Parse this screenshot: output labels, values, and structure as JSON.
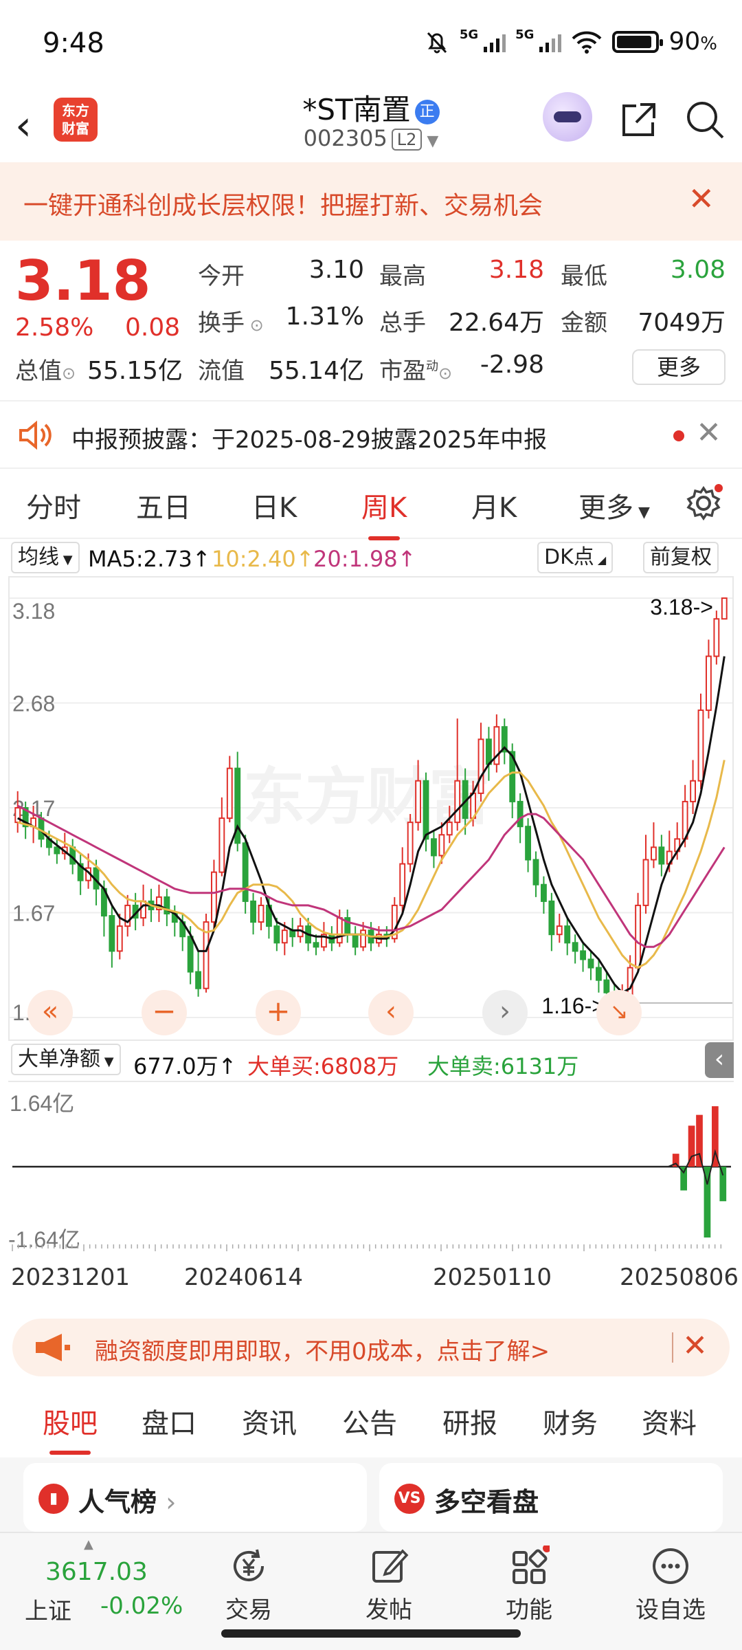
{
  "status_bar": {
    "time": "9:48",
    "net1": "5G",
    "net2": "5G",
    "battery": "90",
    "battery_unit": "%"
  },
  "header": {
    "back": "‹",
    "logo_line1": "东方",
    "logo_line2": "财富",
    "title": "*ST南置",
    "badge": "正",
    "code": "002305",
    "level": "L2"
  },
  "banner": {
    "text": "一键开通科创成长层权限！把握打新、交易机会",
    "close": "✕"
  },
  "quote": {
    "price": "3.18",
    "change_pct": "2.58%",
    "change": "0.08",
    "open_label": "今开",
    "open": "3.10",
    "high_label": "最高",
    "high": "3.18",
    "low_label": "最低",
    "low": "3.08",
    "turnover_label": "换手",
    "turnover": "1.31%",
    "volume_label": "总手",
    "volume": "22.64万",
    "amount_label": "金额",
    "amount": "7049万",
    "mktcap_label": "总值",
    "mktcap": "55.15亿",
    "float_label": "流值",
    "float": "55.14亿",
    "pe_label": "市盈",
    "pe_sup": "动",
    "pe": "-2.98",
    "more": "更多"
  },
  "notice": {
    "text": "中报预披露：于2025-08-29披露2025年中报",
    "close": "✕"
  },
  "kline_tabs": [
    "分时",
    "五日",
    "日K",
    "周K",
    "月K",
    "更多"
  ],
  "ma_row": {
    "selector": "均线",
    "ma5": "MA5:2.73↑",
    "ma10": "10:2.40↑",
    "ma20": "20:1.98↑",
    "dk": "DK点",
    "adjust": "前复权"
  },
  "colors": {
    "up": "#e0302a",
    "down": "#2aa33c",
    "ma5": "#111111",
    "ma10": "#e8b94a",
    "ma20": "#c0357a",
    "accent": "#e0302a"
  },
  "chart_data": {
    "type": "candlestick",
    "y_labels": [
      "3.18",
      "2.68",
      "2.17",
      "1.67",
      "1.16"
    ],
    "ylim": [
      1.16,
      3.18
    ],
    "max_marker": "3.18->",
    "min_marker": "1.16->",
    "x_labels": [
      "20231201",
      "20240614",
      "20250110",
      "20250806"
    ],
    "candles": [
      [
        2.1,
        2.17,
        2.25,
        2.05
      ],
      [
        2.17,
        2.08,
        2.2,
        2.02
      ],
      [
        2.08,
        2.12,
        2.18,
        2.0
      ],
      [
        2.12,
        2.02,
        2.15,
        1.98
      ],
      [
        2.02,
        1.98,
        2.06,
        1.94
      ],
      [
        1.98,
        1.95,
        2.02,
        1.9
      ],
      [
        1.95,
        1.98,
        2.05,
        1.92
      ],
      [
        1.98,
        1.9,
        2.02,
        1.85
      ],
      [
        1.9,
        1.82,
        1.95,
        1.75
      ],
      [
        1.82,
        1.88,
        1.95,
        1.78
      ],
      [
        1.88,
        1.78,
        1.92,
        1.7
      ],
      [
        1.78,
        1.65,
        1.82,
        1.55
      ],
      [
        1.65,
        1.48,
        1.7,
        1.4
      ],
      [
        1.48,
        1.6,
        1.66,
        1.44
      ],
      [
        1.6,
        1.7,
        1.75,
        1.55
      ],
      [
        1.7,
        1.64,
        1.76,
        1.58
      ],
      [
        1.64,
        1.72,
        1.8,
        1.6
      ],
      [
        1.72,
        1.68,
        1.78,
        1.62
      ],
      [
        1.68,
        1.74,
        1.8,
        1.62
      ],
      [
        1.74,
        1.66,
        1.78,
        1.6
      ],
      [
        1.66,
        1.62,
        1.7,
        1.55
      ],
      [
        1.62,
        1.55,
        1.66,
        1.48
      ],
      [
        1.55,
        1.38,
        1.6,
        1.32
      ],
      [
        1.38,
        1.3,
        1.48,
        1.26
      ],
      [
        1.3,
        1.62,
        1.66,
        1.28
      ],
      [
        1.62,
        1.86,
        1.92,
        1.58
      ],
      [
        1.86,
        2.12,
        2.22,
        1.84
      ],
      [
        2.12,
        2.36,
        2.42,
        2.1
      ],
      [
        2.36,
        2.0,
        2.44,
        1.96
      ],
      [
        2.0,
        1.72,
        2.04,
        1.66
      ],
      [
        1.72,
        1.62,
        1.76,
        1.56
      ],
      [
        1.62,
        1.7,
        1.74,
        1.58
      ],
      [
        1.7,
        1.6,
        1.74,
        1.54
      ],
      [
        1.6,
        1.52,
        1.64,
        1.48
      ],
      [
        1.52,
        1.58,
        1.62,
        1.46
      ],
      [
        1.58,
        1.55,
        1.64,
        1.5
      ],
      [
        1.55,
        1.6,
        1.64,
        1.52
      ],
      [
        1.6,
        1.52,
        1.64,
        1.48
      ],
      [
        1.52,
        1.5,
        1.56,
        1.46
      ],
      [
        1.5,
        1.56,
        1.62,
        1.48
      ],
      [
        1.56,
        1.52,
        1.6,
        1.48
      ],
      [
        1.52,
        1.64,
        1.68,
        1.5
      ],
      [
        1.64,
        1.56,
        1.68,
        1.52
      ],
      [
        1.56,
        1.5,
        1.6,
        1.46
      ],
      [
        1.5,
        1.58,
        1.62,
        1.48
      ],
      [
        1.58,
        1.52,
        1.62,
        1.48
      ],
      [
        1.52,
        1.56,
        1.6,
        1.5
      ],
      [
        1.56,
        1.54,
        1.6,
        1.5
      ],
      [
        1.54,
        1.7,
        1.74,
        1.52
      ],
      [
        1.7,
        1.9,
        1.98,
        1.66
      ],
      [
        1.9,
        2.1,
        2.14,
        1.86
      ],
      [
        2.1,
        2.3,
        2.4,
        2.06
      ],
      [
        2.3,
        2.02,
        2.34,
        1.96
      ],
      [
        2.02,
        1.94,
        2.06,
        1.88
      ],
      [
        1.94,
        2.04,
        2.1,
        1.9
      ],
      [
        2.04,
        2.1,
        2.18,
        2.0
      ],
      [
        2.1,
        2.3,
        2.6,
        2.06
      ],
      [
        2.3,
        2.12,
        2.36,
        2.04
      ],
      [
        2.12,
        2.24,
        2.3,
        2.08
      ],
      [
        2.24,
        2.5,
        2.58,
        2.2
      ],
      [
        2.5,
        2.38,
        2.56,
        2.3
      ],
      [
        2.38,
        2.56,
        2.62,
        2.34
      ],
      [
        2.56,
        2.44,
        2.6,
        2.38
      ],
      [
        2.44,
        2.2,
        2.48,
        2.12
      ],
      [
        2.2,
        2.08,
        2.24,
        2.0
      ],
      [
        2.08,
        1.92,
        2.12,
        1.86
      ],
      [
        1.92,
        1.8,
        1.96,
        1.74
      ],
      [
        1.8,
        1.72,
        1.84,
        1.66
      ],
      [
        1.72,
        1.56,
        1.76,
        1.48
      ],
      [
        1.56,
        1.6,
        1.66,
        1.52
      ],
      [
        1.6,
        1.52,
        1.64,
        1.46
      ],
      [
        1.52,
        1.48,
        1.56,
        1.42
      ],
      [
        1.48,
        1.44,
        1.52,
        1.38
      ],
      [
        1.44,
        1.4,
        1.48,
        1.34
      ],
      [
        1.4,
        1.34,
        1.44,
        1.28
      ],
      [
        1.34,
        1.28,
        1.38,
        1.2
      ],
      [
        1.28,
        1.2,
        1.32,
        1.16
      ],
      [
        1.2,
        1.26,
        1.32,
        1.18
      ],
      [
        1.26,
        1.4,
        1.46,
        1.22
      ],
      [
        1.4,
        1.7,
        1.76,
        1.38
      ],
      [
        1.7,
        1.92,
        2.04,
        1.66
      ],
      [
        1.92,
        1.98,
        2.1,
        1.88
      ],
      [
        1.98,
        1.9,
        2.04,
        1.84
      ],
      [
        1.9,
        1.96,
        2.06,
        1.86
      ],
      [
        1.96,
        2.02,
        2.1,
        1.92
      ],
      [
        2.02,
        2.2,
        2.28,
        1.98
      ],
      [
        2.2,
        2.3,
        2.4,
        2.14
      ],
      [
        2.3,
        2.64,
        2.72,
        2.26
      ],
      [
        2.64,
        2.9,
        2.98,
        2.6
      ],
      [
        2.9,
        3.08,
        3.12,
        2.86
      ],
      [
        3.08,
        3.18,
        3.18,
        3.08
      ]
    ],
    "ma5": [
      2.12,
      2.1,
      2.08,
      2.06,
      2.02,
      1.99,
      1.96,
      1.93,
      1.89,
      1.86,
      1.82,
      1.78,
      1.7,
      1.64,
      1.62,
      1.66,
      1.7,
      1.7,
      1.7,
      1.68,
      1.66,
      1.62,
      1.56,
      1.48,
      1.48,
      1.58,
      1.76,
      1.98,
      2.08,
      2.02,
      1.92,
      1.82,
      1.7,
      1.62,
      1.6,
      1.58,
      1.58,
      1.56,
      1.55,
      1.55,
      1.54,
      1.55,
      1.56,
      1.56,
      1.56,
      1.55,
      1.54,
      1.54,
      1.58,
      1.66,
      1.8,
      1.96,
      2.04,
      2.06,
      2.08,
      2.12,
      2.16,
      2.2,
      2.24,
      2.32,
      2.38,
      2.42,
      2.46,
      2.42,
      2.34,
      2.2,
      2.06,
      1.92,
      1.8,
      1.72,
      1.64,
      1.58,
      1.52,
      1.48,
      1.44,
      1.38,
      1.32,
      1.28,
      1.3,
      1.38,
      1.52,
      1.66,
      1.8,
      1.9,
      1.96,
      2.02,
      2.1,
      2.24,
      2.44,
      2.66,
      2.9
    ],
    "ma10": [
      2.1,
      2.09,
      2.08,
      2.06,
      2.04,
      2.02,
      2.0,
      1.98,
      1.95,
      1.92,
      1.89,
      1.85,
      1.8,
      1.76,
      1.73,
      1.72,
      1.72,
      1.7,
      1.69,
      1.68,
      1.67,
      1.66,
      1.63,
      1.59,
      1.57,
      1.58,
      1.63,
      1.7,
      1.76,
      1.78,
      1.8,
      1.8,
      1.8,
      1.79,
      1.76,
      1.72,
      1.66,
      1.62,
      1.59,
      1.57,
      1.56,
      1.56,
      1.56,
      1.56,
      1.56,
      1.55,
      1.55,
      1.55,
      1.56,
      1.58,
      1.62,
      1.68,
      1.76,
      1.84,
      1.92,
      1.98,
      2.04,
      2.08,
      2.12,
      2.18,
      2.24,
      2.28,
      2.32,
      2.34,
      2.34,
      2.3,
      2.24,
      2.18,
      2.1,
      2.04,
      1.96,
      1.88,
      1.8,
      1.72,
      1.64,
      1.58,
      1.52,
      1.46,
      1.42,
      1.4,
      1.42,
      1.46,
      1.52,
      1.6,
      1.68,
      1.76,
      1.86,
      1.96,
      2.08,
      2.22,
      2.4
    ],
    "ma20": [
      2.18,
      2.16,
      2.14,
      2.12,
      2.1,
      2.08,
      2.06,
      2.04,
      2.02,
      2.0,
      1.98,
      1.96,
      1.94,
      1.92,
      1.9,
      1.88,
      1.86,
      1.84,
      1.82,
      1.8,
      1.78,
      1.77,
      1.76,
      1.76,
      1.76,
      1.76,
      1.77,
      1.78,
      1.78,
      1.78,
      1.77,
      1.76,
      1.74,
      1.72,
      1.71,
      1.7,
      1.7,
      1.7,
      1.69,
      1.68,
      1.66,
      1.64,
      1.62,
      1.61,
      1.6,
      1.59,
      1.58,
      1.58,
      1.58,
      1.59,
      1.6,
      1.62,
      1.64,
      1.66,
      1.68,
      1.72,
      1.76,
      1.8,
      1.84,
      1.88,
      1.92,
      1.98,
      2.04,
      2.08,
      2.12,
      2.14,
      2.14,
      2.12,
      2.08,
      2.04,
      2.0,
      1.96,
      1.92,
      1.86,
      1.8,
      1.74,
      1.68,
      1.62,
      1.56,
      1.52,
      1.5,
      1.5,
      1.52,
      1.56,
      1.62,
      1.68,
      1.74,
      1.8,
      1.86,
      1.92,
      1.98
    ]
  },
  "flow": {
    "selector": "大单净额",
    "net": "677.0万↑",
    "buy": "大单买:6808万",
    "sell": "大单卖:6131万",
    "top_label": "1.64亿",
    "bottom_label": "-1.64亿",
    "ylim": [
      -1.64,
      1.64
    ],
    "bars": [
      0.0,
      0.0,
      0.0,
      0.0,
      0.0,
      0.0,
      0.0,
      0.0,
      0.0,
      0.0,
      0.0,
      0.0,
      0.0,
      0.0,
      0.0,
      0.0,
      0.0,
      0.0,
      0.0,
      0.0,
      0.0,
      0.0,
      0.0,
      0.0,
      0.0,
      0.0,
      0.0,
      0.0,
      0.0,
      0.0,
      0.0,
      0.0,
      0.0,
      0.0,
      0.0,
      0.0,
      0.0,
      0.0,
      0.0,
      0.0,
      0.0,
      0.0,
      0.0,
      0.0,
      0.0,
      0.0,
      0.0,
      0.0,
      0.0,
      0.0,
      0.0,
      0.0,
      0.0,
      0.0,
      0.0,
      0.0,
      0.0,
      0.0,
      0.0,
      0.0,
      0.0,
      0.0,
      0.0,
      0.0,
      0.0,
      0.0,
      0.0,
      0.0,
      0.0,
      0.0,
      0.0,
      0.0,
      0.0,
      0.0,
      0.0,
      0.0,
      0.0,
      0.0,
      0.0,
      0.0,
      0.0,
      0.0,
      0.0,
      0.0,
      0.3,
      -0.55,
      0.95,
      1.2,
      -1.64,
      1.4,
      -0.8
    ]
  },
  "promo": {
    "text": "融资额度即用即取，不用0成本，点击了解>",
    "close": "✕"
  },
  "bottom_tabs": [
    "股吧",
    "盘口",
    "资讯",
    "公告",
    "研报",
    "财务",
    "资料"
  ],
  "cards": {
    "left": "人气榜",
    "left_arrow": "›",
    "right": "多空看盘",
    "right_icon": "VS"
  },
  "bottom_nav": {
    "index_value": "3617.03",
    "index_name": "上证",
    "index_change": "-0.02%",
    "items": [
      "交易",
      "发帖",
      "功能",
      "设自选"
    ]
  }
}
